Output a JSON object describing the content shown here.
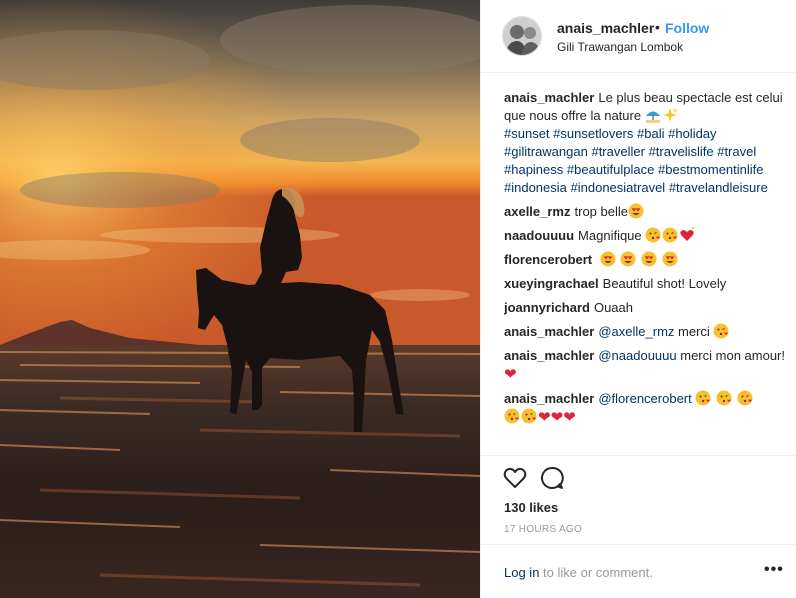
{
  "post": {
    "username": "anais_machler",
    "follow_label": "Follow",
    "separator": "•",
    "location": "Gili Trawangan Lombok"
  },
  "caption": {
    "username": "anais_machler",
    "text": "Le plus beau spectacle est celui que nous offre la nature",
    "hashtags": [
      "#sunset",
      "#sunsetlovers",
      "#bali",
      "#holiday",
      "#gilitrawangan",
      "#traveller",
      "#travelislife",
      "#travel",
      "#hapiness",
      "#beautifulplace",
      "#bestmomentinlife",
      "#indonesia",
      "#indonesiatravel",
      "#travelandleisure"
    ]
  },
  "comments": [
    {
      "username": "axelle_rmz",
      "text": "trop belle"
    },
    {
      "username": "naadouuuu",
      "text": "Magnifique"
    },
    {
      "username": "florencerobert",
      "text": ""
    },
    {
      "username": "xueyingrachael",
      "text": "Beautiful shot! Lovely"
    },
    {
      "username": "joannyrichard",
      "text": "Ouaah"
    },
    {
      "username": "anais_machler",
      "mention": "@axelle_rmz",
      "text": "merci"
    },
    {
      "username": "anais_machler",
      "mention": "@naadouuuu",
      "text": "merci mon amour!"
    },
    {
      "username": "anais_machler",
      "mention": "@florencerobert",
      "text": ""
    }
  ],
  "icons": {
    "like": "heart-outline-icon",
    "comment": "comment-bubble-icon",
    "more": "more-options-icon"
  },
  "stats": {
    "likes": "130 likes",
    "time": "17 HOURS AGO"
  },
  "footer": {
    "login_link": "Log in",
    "login_text": "to like or comment.",
    "more": "•••"
  },
  "colors": {
    "link_blue": "#3897f0",
    "tag_blue": "#003569",
    "muted": "#999999",
    "heart": "#e0233d"
  }
}
